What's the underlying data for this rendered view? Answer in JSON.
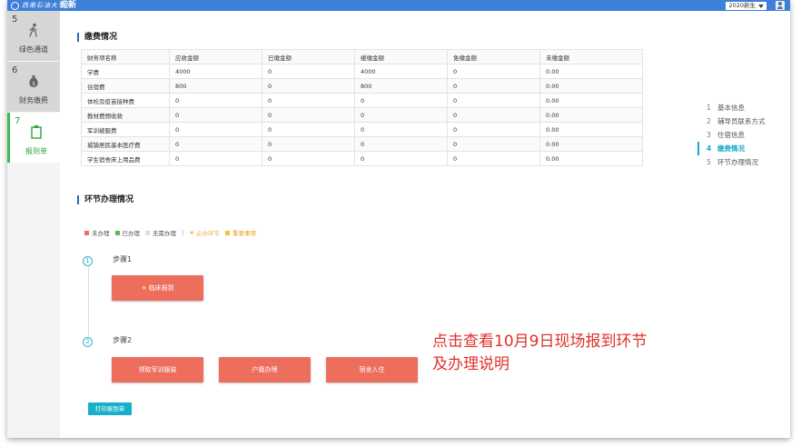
{
  "header": {
    "logo_text": "西南石油大学",
    "app_title": "迎新",
    "term": "2020新生"
  },
  "sidebar": {
    "items": [
      {
        "num": "5",
        "label": "绿色通道",
        "icon": "walking-person-icon"
      },
      {
        "num": "6",
        "label": "财务缴费",
        "icon": "money-bag-icon"
      },
      {
        "num": "7",
        "label": "报到单",
        "icon": "clipboard-icon",
        "active": true
      }
    ]
  },
  "fees": {
    "title": "缴费情况",
    "columns": [
      "财务项名称",
      "应收金额",
      "已缴金额",
      "缓缴金额",
      "免缴金额",
      "未缴金额"
    ],
    "rows": [
      [
        "学费",
        "4000",
        "0",
        "4000",
        "0",
        "0.00"
      ],
      [
        "住宿费",
        "800",
        "0",
        "800",
        "0",
        "0.00"
      ],
      [
        "体检及疫苗接种费",
        "0",
        "0",
        "0",
        "0",
        "0.00"
      ],
      [
        "教材费预收款",
        "0",
        "0",
        "0",
        "0",
        "0.00"
      ],
      [
        "军训被服费",
        "0",
        "0",
        "0",
        "0",
        "0.00"
      ],
      [
        "城镇居民基本医疗费",
        "0",
        "0",
        "0",
        "0",
        "0.00"
      ],
      [
        "学生宿舍床上用品费",
        "0",
        "0",
        "0",
        "0",
        "0.00"
      ]
    ]
  },
  "process": {
    "title": "环节办理情况",
    "legend": {
      "pending": "未办理",
      "done": "已办理",
      "none": "无需办理",
      "separator": "|",
      "required": "必办环节",
      "important": "重要事项"
    },
    "steps": [
      {
        "num": "1",
        "label": "步骤1",
        "buttons": [
          "临床报到"
        ]
      },
      {
        "num": "2",
        "label": "步骤2",
        "buttons": [
          "领取军训服装",
          "户籍办理",
          "宿舍入住"
        ]
      }
    ],
    "print_button": "打印报到单"
  },
  "steps_nav": {
    "items": [
      {
        "num": "1",
        "label": "基本信息"
      },
      {
        "num": "2",
        "label": "辅导员联系方式"
      },
      {
        "num": "3",
        "label": "住宿信息"
      },
      {
        "num": "4",
        "label": "缴费情况",
        "active": true
      },
      {
        "num": "5",
        "label": "环节办理情况"
      }
    ]
  },
  "annotation": {
    "text": "点击查看10月9日现场报到环节及办理说明"
  },
  "colors": {
    "topbar": "#3d7fd9",
    "active_nav": "#3dba4e",
    "process_button": "#ee6e5e",
    "print_button": "#16b1c9",
    "annotation": "#e0302a",
    "legend_pending": "#ee6e5e",
    "legend_done": "#5cb85c",
    "legend_none": "#dddddd",
    "legend_required": "#f0ad4e",
    "legend_important": "#f5c242"
  }
}
